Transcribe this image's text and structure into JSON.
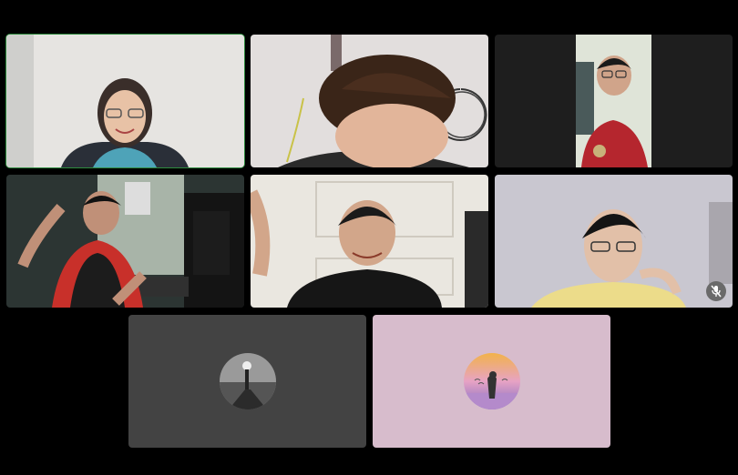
{
  "meeting": {
    "participants": [
      {
        "id": "p1",
        "camera": "on",
        "speaking": true,
        "muted": false
      },
      {
        "id": "p2",
        "camera": "on",
        "speaking": false,
        "muted": false
      },
      {
        "id": "p3",
        "camera": "on",
        "speaking": false,
        "muted": false
      },
      {
        "id": "p4",
        "camera": "on",
        "speaking": false,
        "muted": false
      },
      {
        "id": "p5",
        "camera": "on",
        "speaking": false,
        "muted": false
      },
      {
        "id": "p6",
        "camera": "on",
        "speaking": false,
        "muted": true
      },
      {
        "id": "p7",
        "camera": "off",
        "speaking": false,
        "muted": false,
        "avatar_icon": "profile-photo-icon"
      },
      {
        "id": "p8",
        "camera": "off",
        "speaking": false,
        "muted": false,
        "avatar_icon": "profile-photo-icon"
      }
    ]
  },
  "colors": {
    "background": "#000000",
    "tile_camera_off_1": "#434343",
    "tile_camera_off_2": "#d7bccc",
    "speaking_outline": "#2e8b3e",
    "mute_badge": "#6a6a6a"
  }
}
